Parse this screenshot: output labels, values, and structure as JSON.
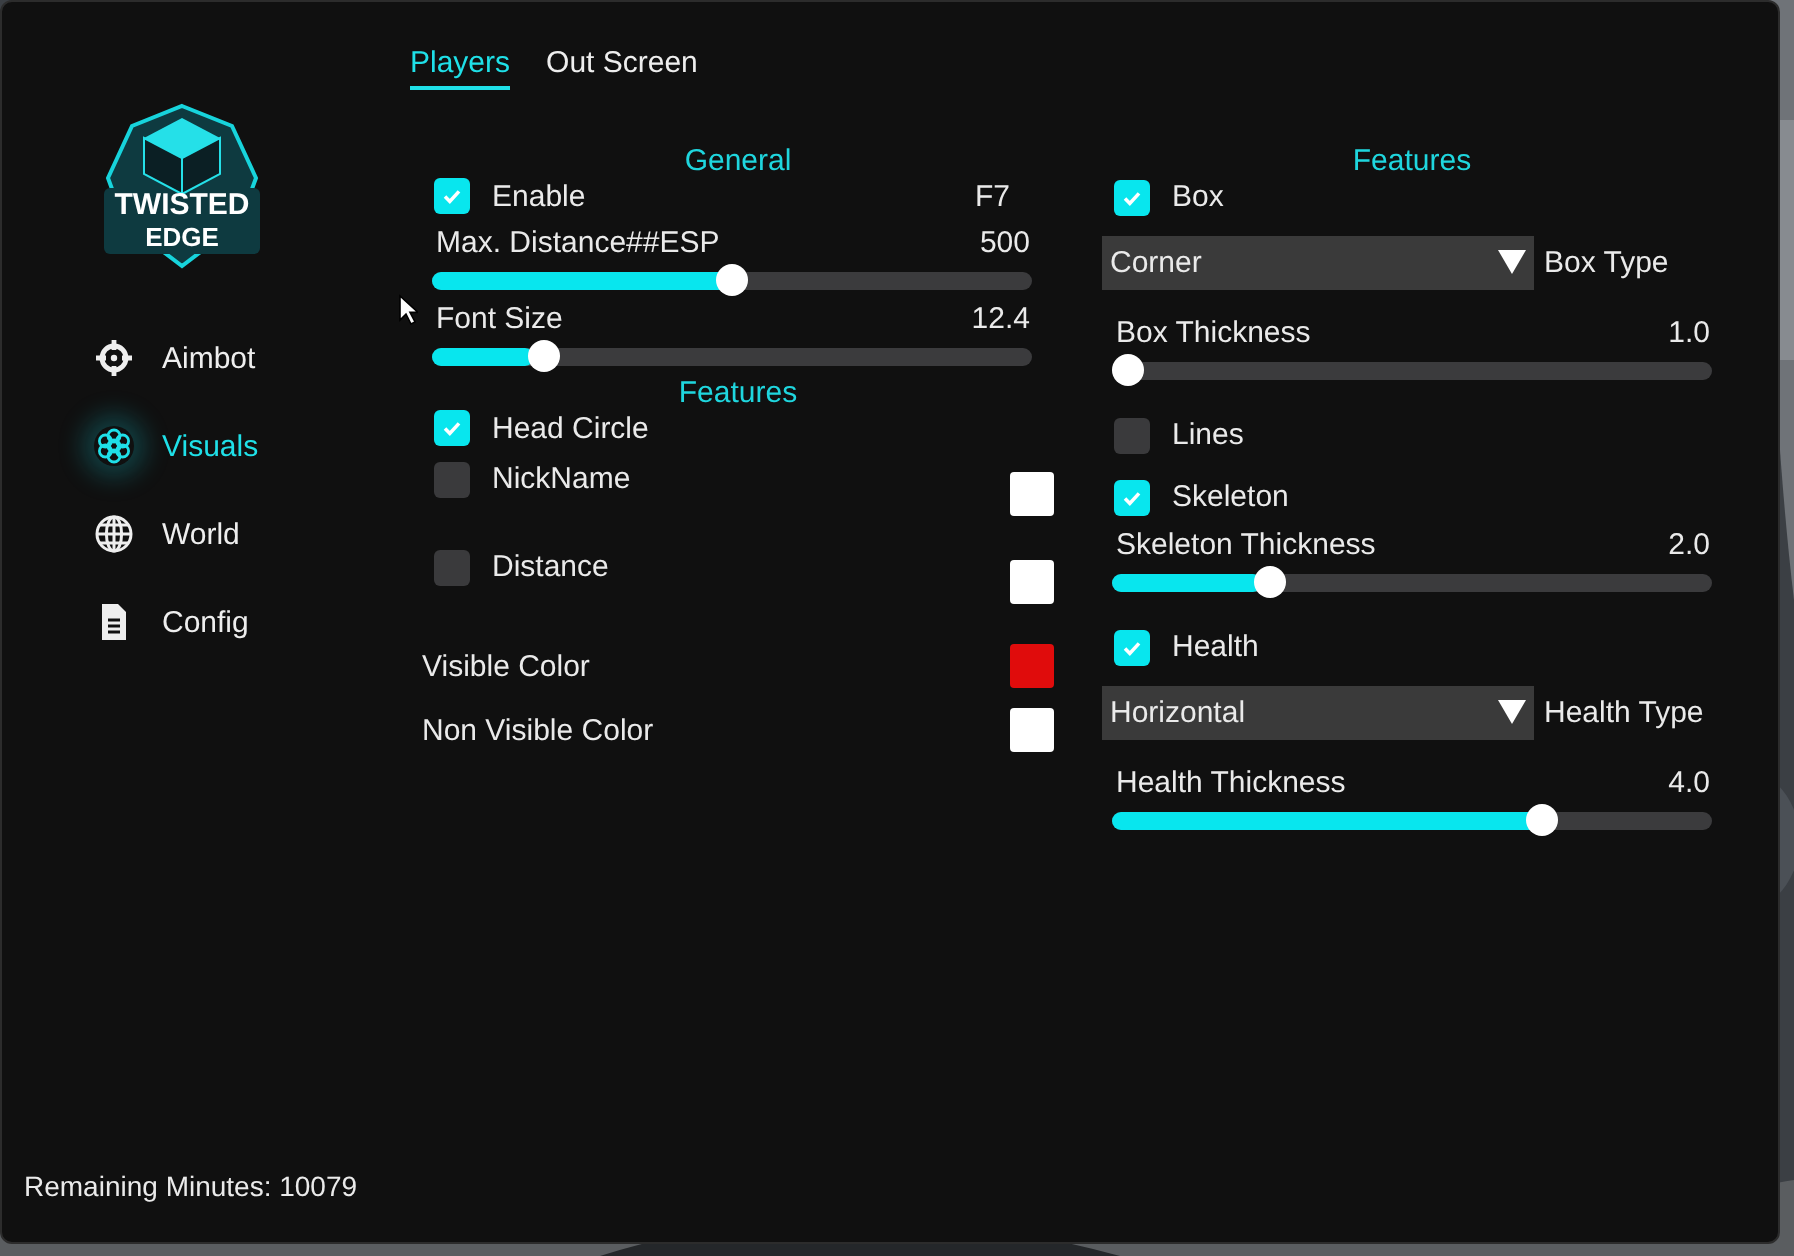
{
  "logo": {
    "line_1": "TWISTED",
    "line_2": "EDGE"
  },
  "sidebar": {
    "items": [
      {
        "label": "Aimbot",
        "selected": false
      },
      {
        "label": "Visuals",
        "selected": true
      },
      {
        "label": "World",
        "selected": false
      },
      {
        "label": "Config",
        "selected": false
      }
    ]
  },
  "tabs": [
    {
      "label": "Players",
      "selected": true
    },
    {
      "label": "Out Screen",
      "selected": false
    }
  ],
  "columns": [
    {
      "items": [
        {
          "kind": "heading",
          "label": "General"
        },
        {
          "kind": "checkbox",
          "label": "Enable",
          "checked": true,
          "hotkey": "F7"
        },
        {
          "kind": "slider",
          "label": "Max. Distance##ESP",
          "reading": "500",
          "level": 0.5
        },
        {
          "kind": "slider",
          "label": "Font Size",
          "reading": "12.4",
          "level": 0.17
        },
        {
          "kind": "heading",
          "label": "Features"
        },
        {
          "kind": "checkbox",
          "label": "Head Circle",
          "checked": true
        },
        {
          "kind": "checkbox",
          "label": "NickName",
          "checked": false,
          "color": "#ffffff"
        },
        {
          "kind": "checkbox",
          "label": "Distance",
          "checked": false,
          "color": "#ffffff"
        },
        {
          "kind": "color",
          "label": "Visible Color",
          "color": "#e00c0c"
        },
        {
          "kind": "color",
          "label": "Non Visible Color",
          "color": "#ffffff"
        }
      ]
    },
    {
      "items": [
        {
          "kind": "heading",
          "label": "Features"
        },
        {
          "kind": "checkbox",
          "label": "Box",
          "checked": true
        },
        {
          "kind": "dropdown",
          "option": "Corner",
          "label": "Box Type"
        },
        {
          "kind": "slider",
          "label": "Box Thickness",
          "reading": "1.0",
          "level": 0
        },
        {
          "kind": "checkbox",
          "label": "Lines",
          "checked": false
        },
        {
          "kind": "checkbox",
          "label": "Skeleton",
          "checked": true
        },
        {
          "kind": "slider",
          "label": "Skeleton Thickness",
          "reading": "2.0",
          "level": 0.25
        },
        {
          "kind": "checkbox",
          "label": "Health",
          "checked": true
        },
        {
          "kind": "dropdown",
          "option": "Horizontal",
          "label": "Health Type"
        },
        {
          "kind": "slider",
          "label": "Health Thickness",
          "reading": "4.0",
          "level": 0.73
        }
      ]
    }
  ],
  "status_bar": {
    "text": "Remaining Minutes: 10079"
  }
}
